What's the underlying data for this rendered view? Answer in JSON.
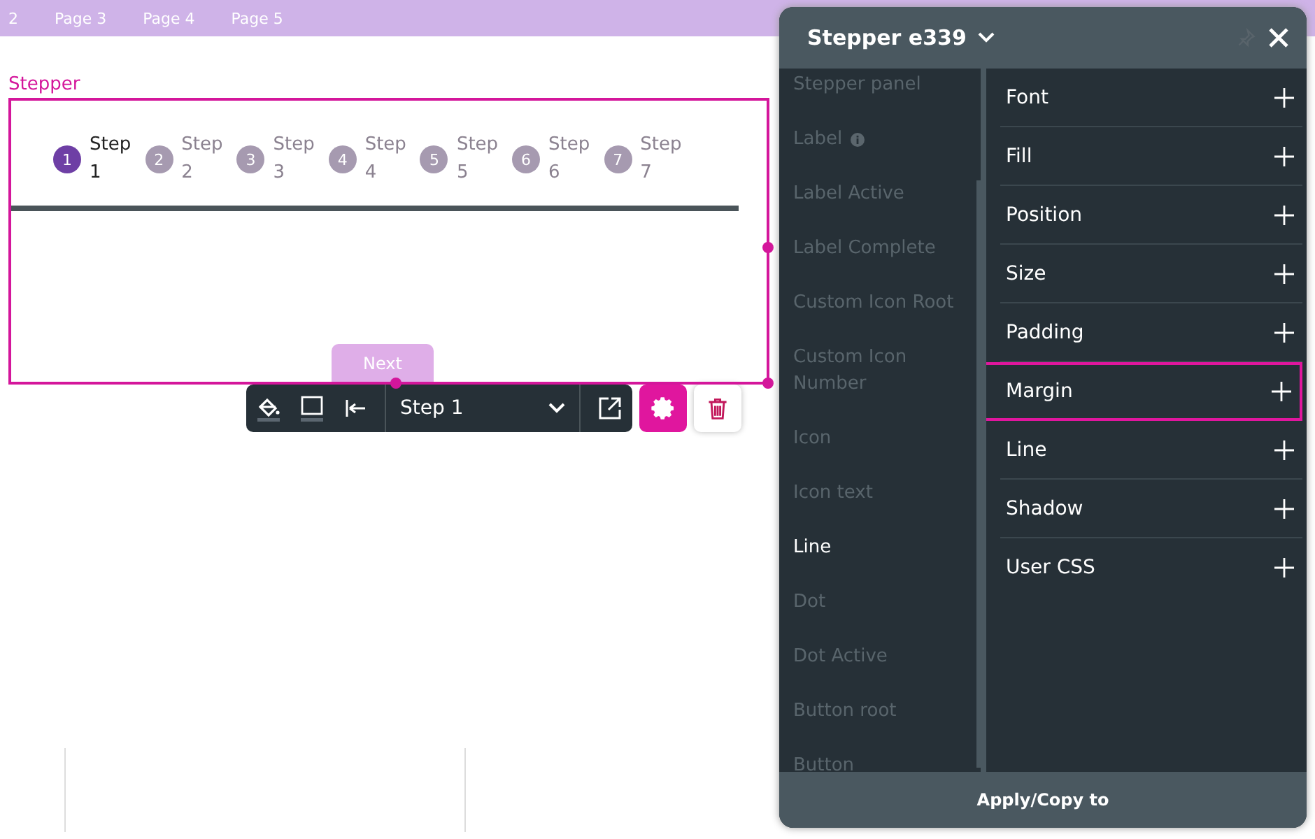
{
  "top_bar": {
    "pages": [
      "2",
      "Page 3",
      "Page 4",
      "Page 5"
    ]
  },
  "stepper": {
    "caption": "Stepper",
    "steps": [
      {
        "number": "1",
        "label": "Step",
        "sub": "1",
        "selected": true
      },
      {
        "number": "2",
        "label": "Step",
        "sub": "2",
        "selected": false
      },
      {
        "number": "3",
        "label": "Step",
        "sub": "3",
        "selected": false
      },
      {
        "number": "4",
        "label": "Step",
        "sub": "4",
        "selected": false
      },
      {
        "number": "5",
        "label": "Step",
        "sub": "5",
        "selected": false
      },
      {
        "number": "6",
        "label": "Step",
        "sub": "6",
        "selected": false
      },
      {
        "number": "7",
        "label": "Step",
        "sub": "7",
        "selected": false
      }
    ],
    "next_button": "Next"
  },
  "toolbar": {
    "step_select": "Step 1"
  },
  "panel": {
    "title": "Stepper e339",
    "parts": [
      {
        "label": "Stepper panel",
        "info": false,
        "selected": false
      },
      {
        "label": "Label",
        "info": true,
        "selected": false
      },
      {
        "label": "Label Active",
        "info": false,
        "selected": false
      },
      {
        "label": "Label Complete",
        "info": false,
        "selected": false
      },
      {
        "label": "Custom Icon Root",
        "info": false,
        "selected": false
      },
      {
        "label": "Custom Icon Number",
        "info": false,
        "selected": false
      },
      {
        "label": "Icon",
        "info": false,
        "selected": false
      },
      {
        "label": "Icon text",
        "info": false,
        "selected": false
      },
      {
        "label": "Line",
        "info": false,
        "selected": true
      },
      {
        "label": "Dot",
        "info": false,
        "selected": false
      },
      {
        "label": "Dot Active",
        "info": false,
        "selected": false
      },
      {
        "label": "Button root",
        "info": false,
        "selected": false
      },
      {
        "label": "Button",
        "info": false,
        "selected": false
      }
    ],
    "properties": [
      {
        "label": "Font",
        "selected": false
      },
      {
        "label": "Fill",
        "selected": false
      },
      {
        "label": "Position",
        "selected": false
      },
      {
        "label": "Size",
        "selected": false
      },
      {
        "label": "Padding",
        "selected": false
      },
      {
        "label": "Margin",
        "selected": true
      },
      {
        "label": "Line",
        "selected": false
      },
      {
        "label": "Shadow",
        "selected": false
      },
      {
        "label": "User CSS",
        "selected": false
      }
    ],
    "footer_button": "Apply/Copy to"
  }
}
